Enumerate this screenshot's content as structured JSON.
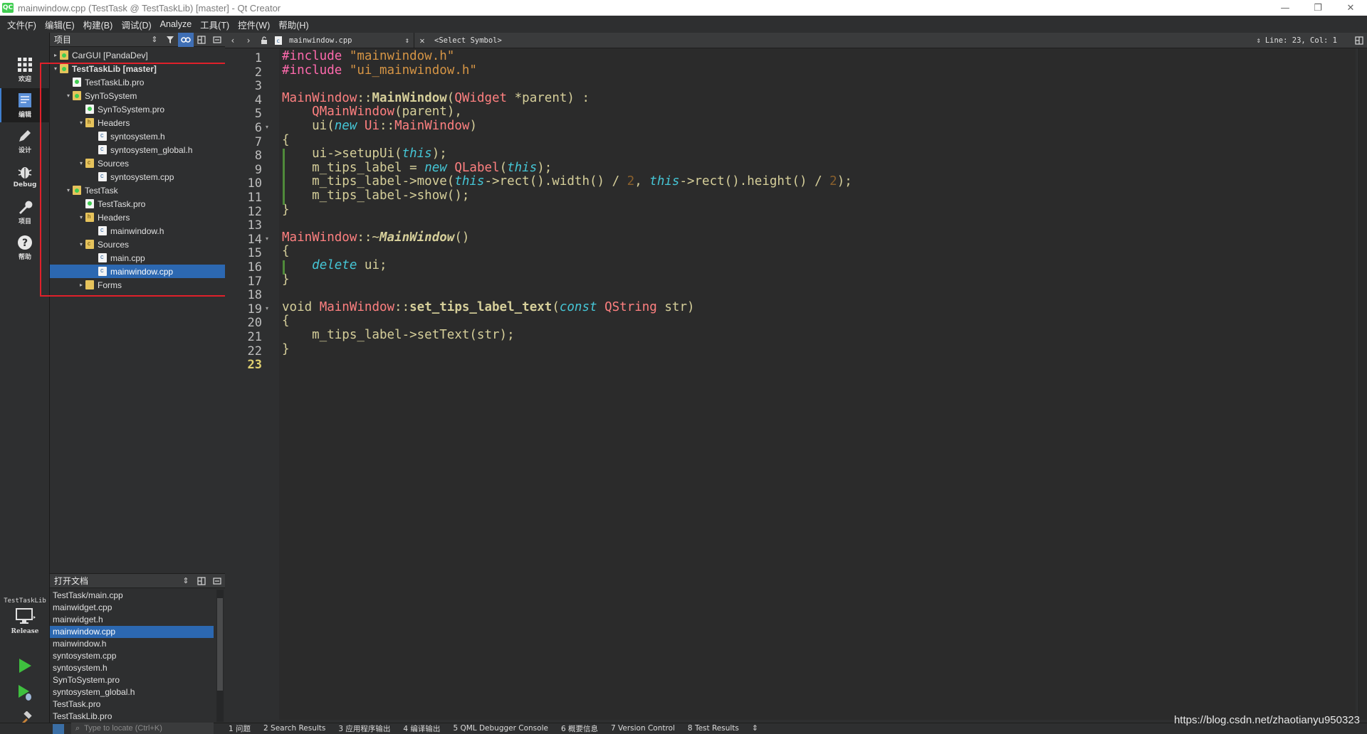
{
  "window": {
    "app_icon": "QC",
    "title": "mainwindow.cpp (TestTask @ TestTaskLib) [master] - Qt Creator",
    "controls": [
      "—",
      "❐",
      "✕"
    ]
  },
  "menu": [
    "文件(F)",
    "编辑(E)",
    "构建(B)",
    "调试(D)",
    "Analyze",
    "工具(T)",
    "控件(W)",
    "帮助(H)"
  ],
  "modes": [
    {
      "label": "欢迎",
      "icon": "welcome-grid-icon"
    },
    {
      "label": "编辑",
      "icon": "edit-document-icon",
      "active": true
    },
    {
      "label": "设计",
      "icon": "design-pencil-icon"
    },
    {
      "label": "Debug",
      "icon": "debug-bug-icon"
    },
    {
      "label": "项目",
      "icon": "projects-wrench-icon"
    },
    {
      "label": "帮助",
      "icon": "help-question-icon"
    }
  ],
  "project_pane": {
    "title": "项目",
    "tree": [
      {
        "label": "CarGUI [PandaDev]",
        "depth": 0,
        "arrow": "▸",
        "icon": "proj"
      },
      {
        "label": "TestTaskLib [master]",
        "depth": 0,
        "arrow": "▾",
        "icon": "proj",
        "bold": true
      },
      {
        "label": "TestTaskLib.pro",
        "depth": 1,
        "arrow": "",
        "icon": "pro"
      },
      {
        "label": "SynToSystem",
        "depth": 1,
        "arrow": "▾",
        "icon": "proj"
      },
      {
        "label": "SynToSystem.pro",
        "depth": 2,
        "arrow": "",
        "icon": "pro"
      },
      {
        "label": "Headers",
        "depth": 2,
        "arrow": "▾",
        "icon": "folder hdr"
      },
      {
        "label": "syntosystem.h",
        "depth": 3,
        "arrow": "",
        "icon": "file"
      },
      {
        "label": "syntosystem_global.h",
        "depth": 3,
        "arrow": "",
        "icon": "file"
      },
      {
        "label": "Sources",
        "depth": 2,
        "arrow": "▾",
        "icon": "folder src"
      },
      {
        "label": "syntosystem.cpp",
        "depth": 3,
        "arrow": "",
        "icon": "file"
      },
      {
        "label": "TestTask",
        "depth": 1,
        "arrow": "▾",
        "icon": "proj"
      },
      {
        "label": "TestTask.pro",
        "depth": 2,
        "arrow": "",
        "icon": "pro"
      },
      {
        "label": "Headers",
        "depth": 2,
        "arrow": "▾",
        "icon": "folder hdr"
      },
      {
        "label": "mainwindow.h",
        "depth": 3,
        "arrow": "",
        "icon": "file"
      },
      {
        "label": "Sources",
        "depth": 2,
        "arrow": "▾",
        "icon": "folder src"
      },
      {
        "label": "main.cpp",
        "depth": 3,
        "arrow": "",
        "icon": "file"
      },
      {
        "label": "mainwindow.cpp",
        "depth": 3,
        "arrow": "",
        "icon": "file",
        "selected": true
      },
      {
        "label": "Forms",
        "depth": 2,
        "arrow": "▸",
        "icon": "folder"
      }
    ]
  },
  "open_docs": {
    "title": "打开文档",
    "items": [
      "TestTask/main.cpp",
      "mainwidget.cpp",
      "mainwidget.h",
      "mainwindow.cpp",
      "mainwindow.h",
      "syntosystem.cpp",
      "syntosystem.h",
      "SynToSystem.pro",
      "syntosystem_global.h",
      "TestTask.pro",
      "TestTaskLib.pro"
    ],
    "selected_index": 3
  },
  "kit": {
    "project": "TestTaskLib",
    "config": "Release"
  },
  "editor_toolbar": {
    "file": "mainwindow.cpp",
    "symbol": "<Select Symbol>",
    "position": "Line: 23, Col: 1"
  },
  "editor": {
    "current_line": 23,
    "lines": [
      [
        [
          "pp",
          "#include "
        ],
        [
          "str",
          "\"mainwindow.h\""
        ]
      ],
      [
        [
          "pp",
          "#include "
        ],
        [
          "str",
          "\"ui_mainwindow.h\""
        ]
      ],
      [],
      [
        [
          "cls",
          "MainWindow"
        ],
        [
          "plain",
          "::"
        ],
        [
          "fn",
          "MainWindow"
        ],
        [
          "plain",
          "("
        ],
        [
          "cls",
          "QWidget"
        ],
        [
          "plain",
          " *parent) :"
        ]
      ],
      [
        [
          "plain",
          "    "
        ],
        [
          "cls",
          "QMainWindow"
        ],
        [
          "plain",
          "(parent),"
        ]
      ],
      [
        [
          "plain",
          "    ui("
        ],
        [
          "kw",
          "new"
        ],
        [
          "plain",
          " "
        ],
        [
          "cls",
          "Ui"
        ],
        [
          "plain",
          "::"
        ],
        [
          "cls",
          "MainWindow"
        ],
        [
          "plain",
          ")"
        ]
      ],
      [
        [
          "plain",
          "{"
        ]
      ],
      [
        [
          "plain",
          "    ui->setupUi("
        ],
        [
          "kw",
          "this"
        ],
        [
          "plain",
          ");"
        ]
      ],
      [
        [
          "plain",
          "    m_tips_label = "
        ],
        [
          "kw",
          "new"
        ],
        [
          "plain",
          " "
        ],
        [
          "cls",
          "QLabel"
        ],
        [
          "plain",
          "("
        ],
        [
          "kw",
          "this"
        ],
        [
          "plain",
          ");"
        ]
      ],
      [
        [
          "plain",
          "    m_tips_label->move("
        ],
        [
          "kw",
          "this"
        ],
        [
          "plain",
          "->rect().width() / "
        ],
        [
          "num",
          "2"
        ],
        [
          "plain",
          ", "
        ],
        [
          "kw",
          "this"
        ],
        [
          "plain",
          "->rect().height() / "
        ],
        [
          "num",
          "2"
        ],
        [
          "plain",
          ");"
        ]
      ],
      [
        [
          "plain",
          "    m_tips_label->show();"
        ]
      ],
      [
        [
          "plain",
          "}"
        ]
      ],
      [],
      [
        [
          "cls",
          "MainWindow"
        ],
        [
          "plain",
          "::~"
        ],
        [
          "fni",
          "MainWindow"
        ],
        [
          "plain",
          "()"
        ]
      ],
      [
        [
          "plain",
          "{"
        ]
      ],
      [
        [
          "plain",
          "    "
        ],
        [
          "kw",
          "delete"
        ],
        [
          "plain",
          " ui;"
        ]
      ],
      [
        [
          "plain",
          "}"
        ]
      ],
      [],
      [
        [
          "plain",
          "void "
        ],
        [
          "cls",
          "MainWindow"
        ],
        [
          "plain",
          "::"
        ],
        [
          "fn",
          "set_tips_label_text"
        ],
        [
          "plain",
          "("
        ],
        [
          "kw",
          "const"
        ],
        [
          "plain",
          " "
        ],
        [
          "cls",
          "QString"
        ],
        [
          "plain",
          " str)"
        ]
      ],
      [
        [
          "plain",
          "{"
        ]
      ],
      [
        [
          "plain",
          "    m_tips_label->setText(str);"
        ]
      ],
      [
        [
          "plain",
          "}"
        ]
      ],
      []
    ],
    "fold_lines": [
      6,
      14,
      19
    ]
  },
  "locator_placeholder": "Type to locate (Ctrl+K)",
  "output_tabs": [
    "1 问题",
    "2 Search Results",
    "3 应用程序输出",
    "4 编译输出",
    "5 QML Debugger Console",
    "6 概要信息",
    "7 Version Control",
    "8 Test Results"
  ],
  "watermark": "https://blog.csdn.net/zhaotianyu950323",
  "colors": {
    "selection": "#2c68b1",
    "highlight_box": "#e0202a",
    "accent": "#41cd52"
  }
}
